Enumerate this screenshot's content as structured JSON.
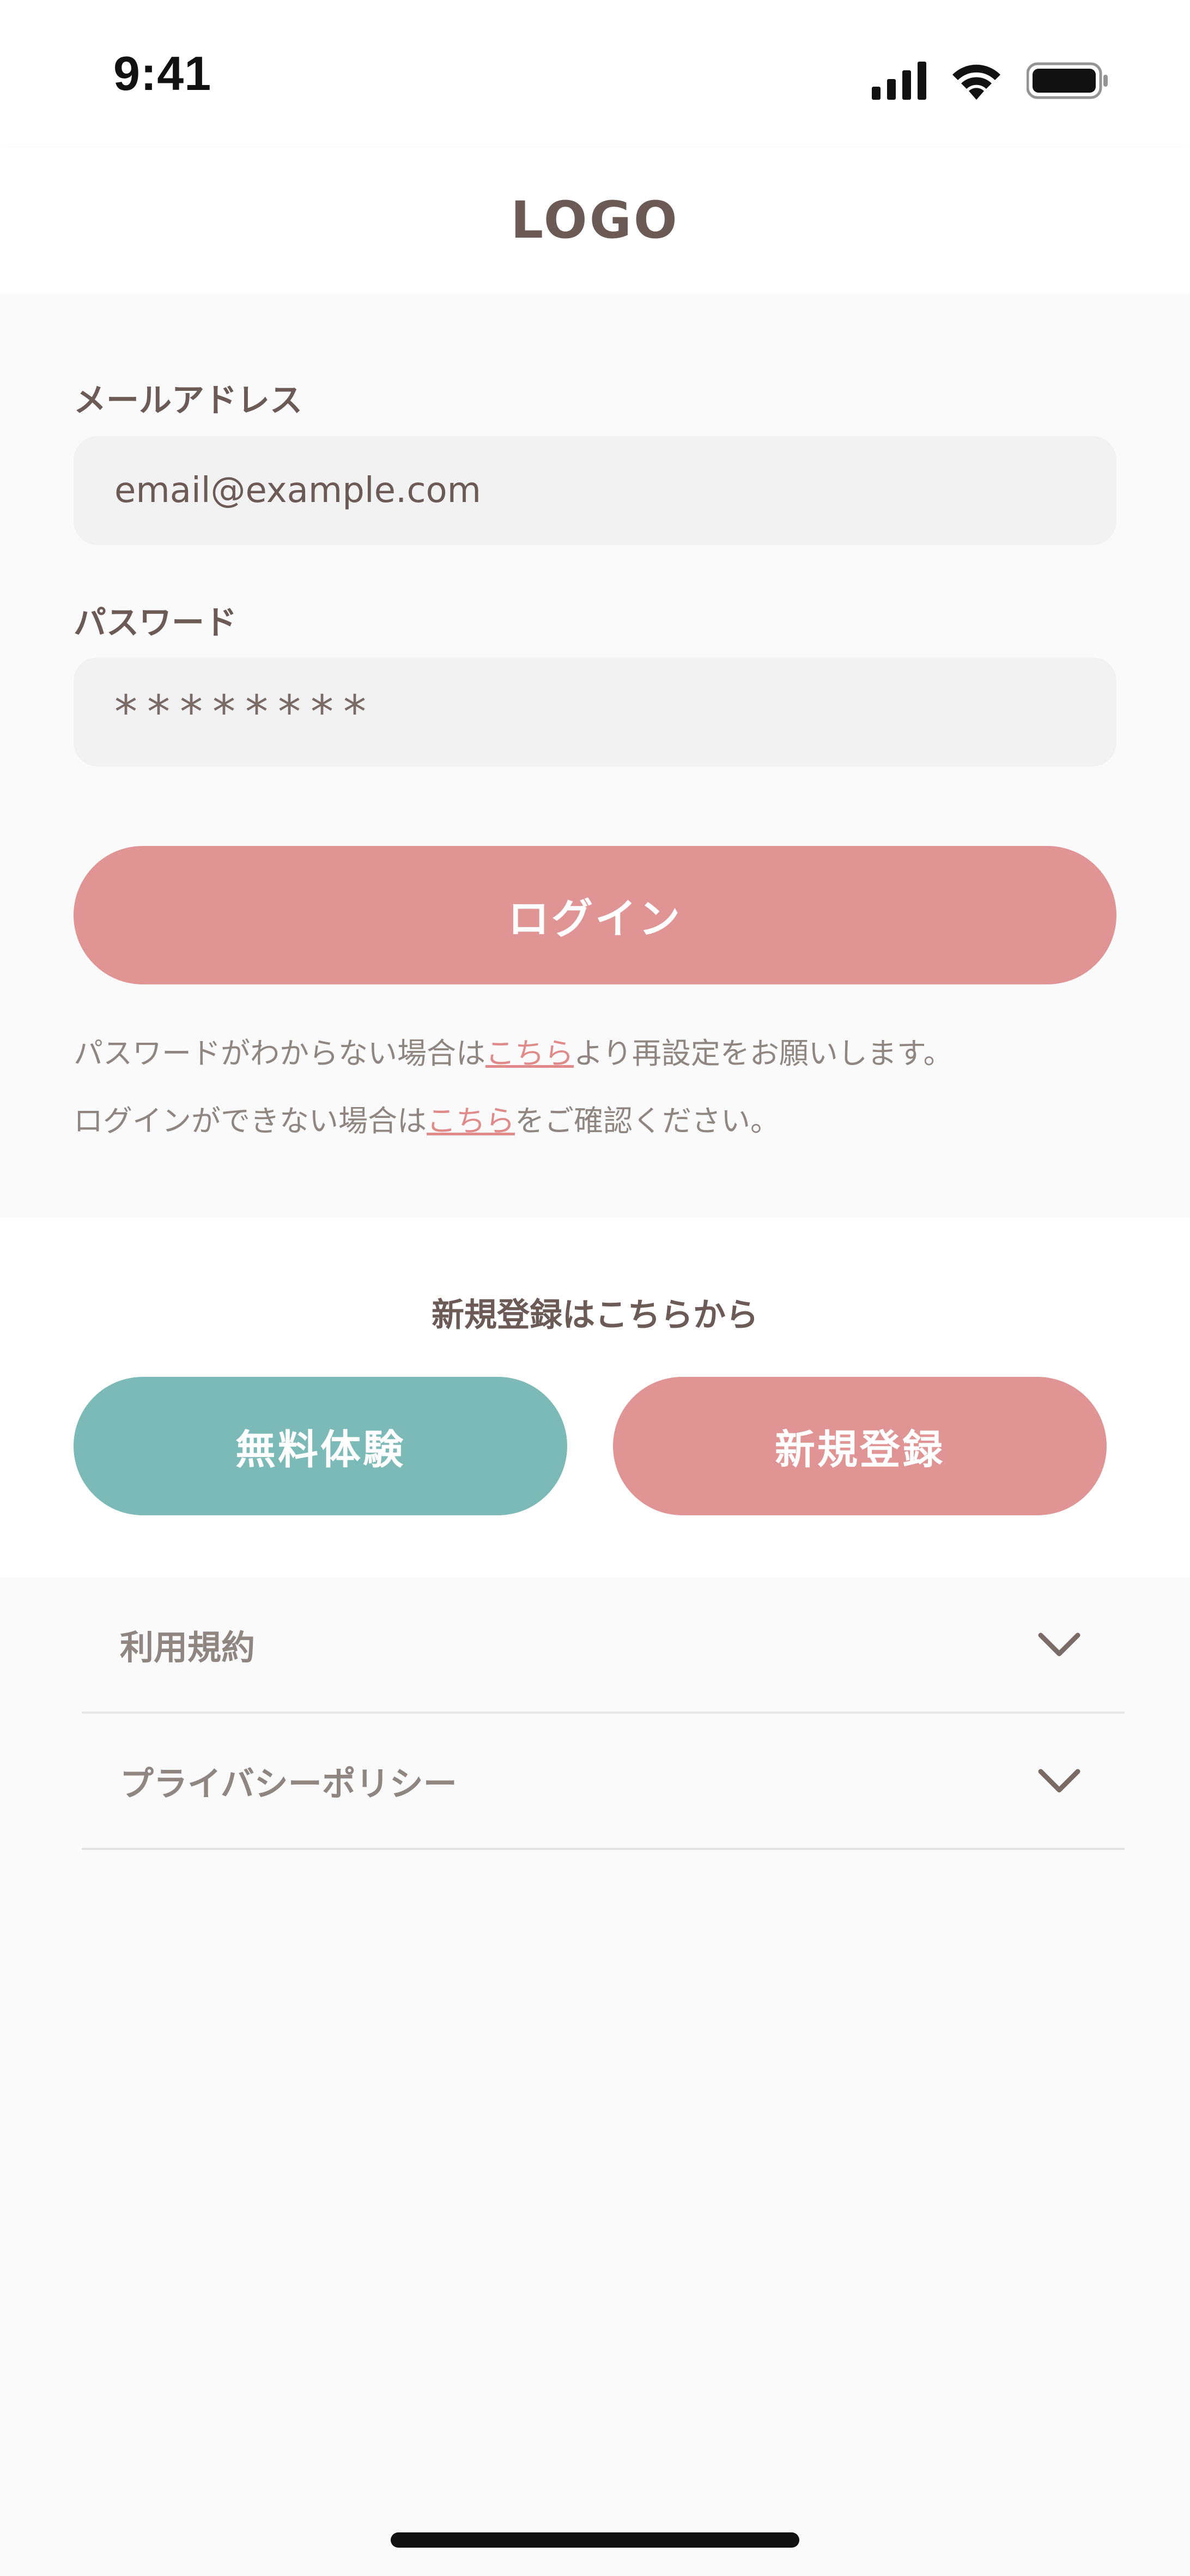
{
  "status_bar": {
    "time": "9:41",
    "icons": [
      "cellular-signal-icon",
      "wifi-icon",
      "battery-icon"
    ]
  },
  "header": {
    "logo": "LOGO"
  },
  "login_form": {
    "email_label": "メールアドレス",
    "email_value": "email@example.com",
    "password_label": "パスワード",
    "password_value": "********",
    "login_button": "ログイン",
    "forgot_password": {
      "before": "パスワードがわからない場合は",
      "link": "こちら",
      "after": "より再設定をお願いします。"
    },
    "cannot_login": {
      "before": "ログインができない場合は",
      "link": "こちら",
      "after": "をご確認ください。"
    }
  },
  "register": {
    "heading": "新規登録はこちらから",
    "trial_button": "無料体験",
    "signup_button": "新規登録"
  },
  "policies": {
    "items": [
      {
        "label": "利用規約"
      },
      {
        "label": "プライバシーポリシー"
      }
    ]
  },
  "colors": {
    "primary_pink": "#e09494",
    "primary_teal": "#7bbab7",
    "text_brown": "#6b5a55",
    "text_muted": "#8f8682",
    "input_bg": "#f2f2f2",
    "page_bg": "#fafafa"
  }
}
